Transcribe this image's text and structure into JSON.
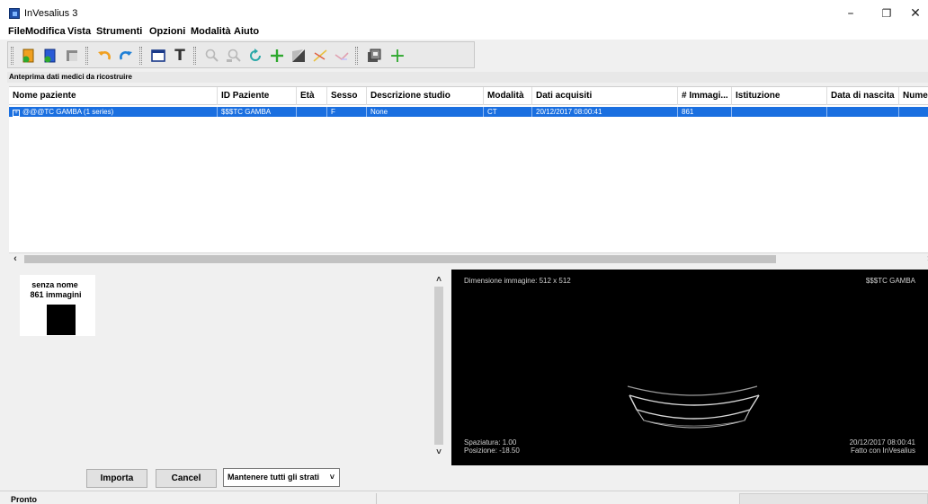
{
  "window": {
    "title": "InVesalius 3",
    "controls": {
      "minimize": "–",
      "maximize": "❐",
      "close": "✕"
    }
  },
  "menu": [
    "File",
    "Modifica",
    "Vista",
    "Strumenti",
    "Opzioni",
    "Modalità",
    "Aiuto"
  ],
  "toolbar": {
    "icons": [
      "import-dicom-icon",
      "open-project-icon",
      "close-project-icon",
      "undo-icon",
      "redo-icon",
      "window-layout-icon",
      "text-icon",
      "zoom-icon",
      "zoom-region-icon",
      "rotate-icon",
      "move-icon",
      "contrast-icon",
      "measure-icon",
      "angle-icon",
      "screenshot-icon",
      "add-icon"
    ],
    "text_glyph": "T",
    "add_glyph": "+"
  },
  "section_header": "Anteprima dati medici da ricostruire",
  "table": {
    "columns": [
      "Nome paziente",
      "ID Paziente",
      "Età",
      "Sesso",
      "Descrizione studio",
      "Modalità",
      "Dati acquisiti",
      "# Immagi...",
      "Istituzione",
      "Data di nascita",
      "Nume"
    ],
    "expander_glyph": "+",
    "rows": [
      [
        "@@@TC GAMBA (1 series)",
        "$$$TC GAMBA",
        "",
        "F",
        "None",
        "CT",
        "20/12/2017 08:00:41",
        "861",
        "",
        "",
        ""
      ]
    ]
  },
  "hscroll": {
    "left_arrow": "‹",
    "right_arrow": "›"
  },
  "vscroll": {
    "up_arrow": "˄",
    "down_arrow": "˅"
  },
  "thumbnail": {
    "name": "senza nome",
    "count": "861 immagini"
  },
  "viewer": {
    "top_left": "Dimensione immagine: 512 x 512",
    "top_right": "$$$TC GAMBA",
    "bottom_left_1": "Spaziatura: 1.00",
    "bottom_left_2": "Posizione: -18.50",
    "bottom_right_1": "20/12/2017 08:00:41",
    "bottom_right_2": "Fatto con InVesalius"
  },
  "actions": {
    "import": "Importa",
    "cancel": "Cancel",
    "layers_select": "Mantenere tutti gli strati",
    "select_chevron": "˅"
  },
  "status": {
    "text": "Pronto"
  },
  "colors": {
    "selection": "#1a6fe0",
    "viewer_bg": "#000000",
    "accent_orange": "#f0a020",
    "accent_green": "#2da82d"
  }
}
